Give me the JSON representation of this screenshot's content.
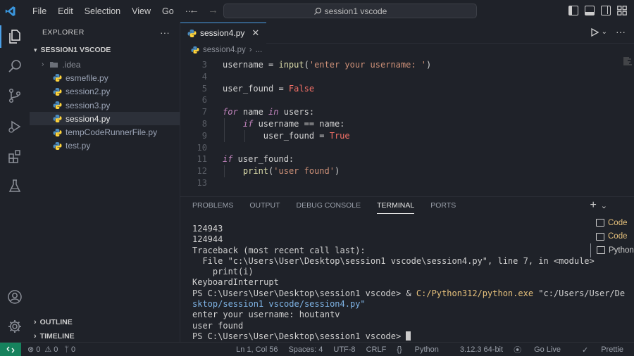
{
  "menu": [
    "File",
    "Edit",
    "Selection",
    "View",
    "Go",
    "···"
  ],
  "command_center": "session1 vscode",
  "sidebar": {
    "title": "EXPLORER",
    "more": "···",
    "folder": "SESSION1 VSCODE",
    "items": [
      {
        "label": ".idea",
        "type": "folder"
      },
      {
        "label": "esmefile.py",
        "type": "py"
      },
      {
        "label": "session2.py",
        "type": "py"
      },
      {
        "label": "session3.py",
        "type": "py"
      },
      {
        "label": "session4.py",
        "type": "py",
        "selected": true
      },
      {
        "label": "tempCodeRunnerFile.py",
        "type": "py"
      },
      {
        "label": "test.py",
        "type": "py"
      }
    ],
    "outline": "OUTLINE",
    "timeline": "TIMELINE"
  },
  "editor": {
    "tab": "session4.py",
    "breadcrumb_file": "session4.py",
    "breadcrumb_more": "...",
    "line_numbers": [
      "3",
      "4",
      "5",
      "6",
      "7",
      "8",
      "9",
      "10",
      "11",
      "12",
      "13"
    ]
  },
  "panel": {
    "tabs": [
      "PROBLEMS",
      "OUTPUT",
      "DEBUG CONSOLE",
      "TERMINAL",
      "PORTS"
    ],
    "active_tab": "TERMINAL",
    "terminal_lines": [
      "124943",
      "124944",
      "Traceback (most recent call last):",
      "  File \"c:\\Users\\User\\Desktop\\session1 vscode\\session4.py\", line 7, in <module>",
      "    print(i)",
      "KeyboardInterrupt"
    ],
    "prompt": "PS C:\\Users\\User\\Desktop\\session1 vscode> ",
    "cmd_amp": "& ",
    "cmd_exe": "C:/Python312/python.exe",
    "cmd_arg1": " \"c:/Users/User/De",
    "cmd_arg2": "sktop/session1 vscode/session4.py\"",
    "output_1": "enter your username: houtantv",
    "output_2": "user found",
    "terminals": [
      "Code",
      "Code",
      "Python"
    ]
  },
  "status": {
    "errors": "0",
    "warnings": "0",
    "ports": "0",
    "position": "Ln 1, Col 56",
    "spaces": "Spaces: 4",
    "encoding": "UTF-8",
    "eol": "CRLF",
    "language": "Python",
    "interpreter": "3.12.3 64-bit",
    "golive": "Go Live",
    "prettier": "Prettie"
  },
  "colors": {
    "accent": "#4b9fe6",
    "remote": "#16825d",
    "keyword": "#c586c0",
    "string": "#ce9178",
    "boolean": "#f47067",
    "function": "#dcdcaa"
  }
}
